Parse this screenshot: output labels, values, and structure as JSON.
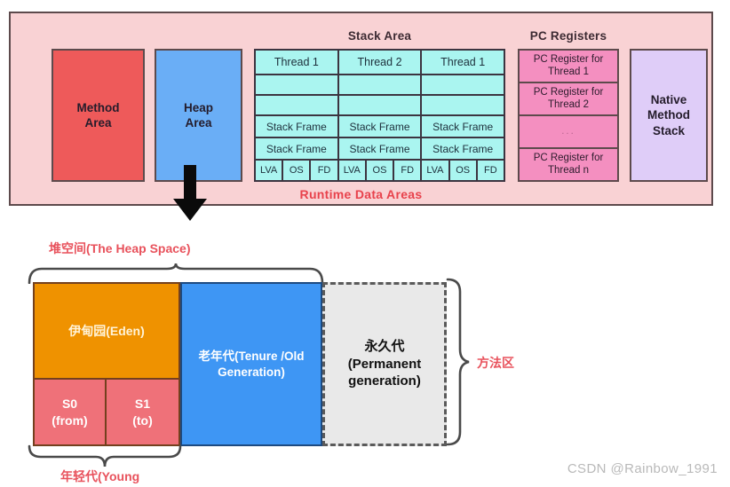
{
  "runtime_data_areas": {
    "caption": "Runtime Data Areas",
    "method_area_label": "Method\nArea",
    "method_area_line1": "Method",
    "method_area_line2": "Area",
    "heap_area_line1": "Heap",
    "heap_area_line2": "Area",
    "native_method_stack_line1": "Native",
    "native_method_stack_line2": "Method",
    "native_method_stack_line3": "Stack",
    "stack_area_title": "Stack Area",
    "pc_registers_title": "PC Registers",
    "colors": {
      "panel_background": "#f9d2d4",
      "panel_border": "#5d4a4c",
      "method_area": "#ee5a5a",
      "heap_area": "#6aaef6",
      "native_method_stack": "#dfcdf8",
      "stack_cell": "#aaf5f0",
      "pc_register_cell": "#f48fc0",
      "caption_text": "#e8424c"
    },
    "stack_area": {
      "threads": [
        {
          "header": "Thread 1",
          "blank_rows": [
            "",
            ""
          ],
          "frames": [
            "Stack Frame",
            "Stack Frame"
          ],
          "sub_cells": [
            "LVA",
            "OS",
            "FD"
          ]
        },
        {
          "header": "Thread 2",
          "blank_rows": [
            "",
            ""
          ],
          "frames": [
            "Stack Frame",
            "Stack Frame"
          ],
          "sub_cells": [
            "LVA",
            "OS",
            "FD"
          ]
        },
        {
          "header": "Thread 1",
          "blank_rows": [
            "",
            ""
          ],
          "frames": [
            "Stack Frame",
            "Stack Frame"
          ],
          "sub_cells": [
            "LVA",
            "OS",
            "FD"
          ]
        }
      ]
    },
    "pc_registers": {
      "rows": [
        "PC Register for Thread 1",
        "PC Register for Thread 2",
        "...",
        "PC Register for Thread n"
      ]
    }
  },
  "heap_detail": {
    "heap_space_label": "堆空间(The Heap Space)",
    "method_area_label": "方法区",
    "young_gen_label": "年轻代(Young",
    "eden_label": "伊甸园(Eden)",
    "s0_line1": "S0",
    "s0_line2": "(from)",
    "s1_line1": "S1",
    "s1_line2": "(to)",
    "old_gen_line1": "老年代(Tenure /Old",
    "old_gen_line2": "Generation)",
    "perm_gen_line1": "永久代",
    "perm_gen_line2": "(Permanent",
    "perm_gen_line3": "generation)",
    "colors": {
      "eden": "#ef9200",
      "survivor": "#ef7179",
      "old_generation": "#3e96f4",
      "permanent_generation": "#e9e9e9",
      "label_text": "#e8525c"
    }
  },
  "watermark": "CSDN @Rainbow_1991"
}
